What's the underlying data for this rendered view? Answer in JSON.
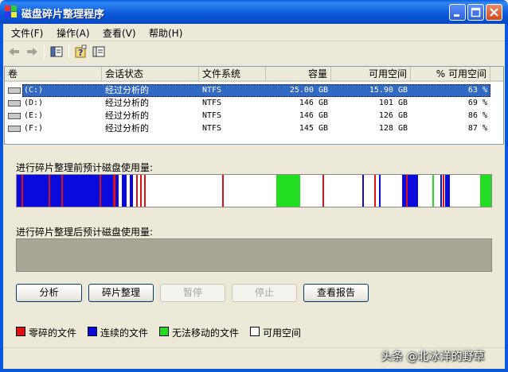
{
  "window": {
    "title": "磁盘碎片整理程序"
  },
  "menu": [
    {
      "label": "文件(F)"
    },
    {
      "label": "操作(A)"
    },
    {
      "label": "查看(V)"
    },
    {
      "label": "帮助(H)"
    }
  ],
  "columns": [
    "卷",
    "会话状态",
    "文件系统",
    "容量",
    "可用空间",
    "% 可用空间"
  ],
  "volumes": [
    {
      "vol": "(C:)",
      "status": "经过分析的",
      "fs": "NTFS",
      "capacity": "25.00 GB",
      "free": "15.90 GB",
      "pct": "63 %",
      "selected": true
    },
    {
      "vol": "(D:)",
      "status": "经过分析的",
      "fs": "NTFS",
      "capacity": "146 GB",
      "free": "101 GB",
      "pct": "69 %"
    },
    {
      "vol": "(E:)",
      "status": "经过分析的",
      "fs": "NTFS",
      "capacity": "146 GB",
      "free": "126 GB",
      "pct": "86 %"
    },
    {
      "vol": "(F:)",
      "status": "经过分析的",
      "fs": "NTFS",
      "capacity": "145 GB",
      "free": "128 GB",
      "pct": "87 %"
    }
  ],
  "before_label": "进行碎片整理前预计磁盘使用量:",
  "after_label": "进行碎片整理后预计磁盘使用量:",
  "buttons": {
    "analyze": "分析",
    "defrag": "碎片整理",
    "pause": "暂停",
    "stop": "停止",
    "report": "查看报告"
  },
  "legend": [
    {
      "label": "零碎的文件",
      "color": "#e01010"
    },
    {
      "label": "连续的文件",
      "color": "#0a0adc"
    },
    {
      "label": "无法移动的文件",
      "color": "#22dd22"
    },
    {
      "label": "可用空间",
      "color": "#ffffff"
    }
  ],
  "colors": {
    "selection": "#316ac5",
    "fragmented": "#e01010",
    "contiguous": "#0a0adc",
    "unmovable": "#22dd22",
    "free": "#ffffff"
  },
  "watermark": "头条 @北冰洋的野草"
}
